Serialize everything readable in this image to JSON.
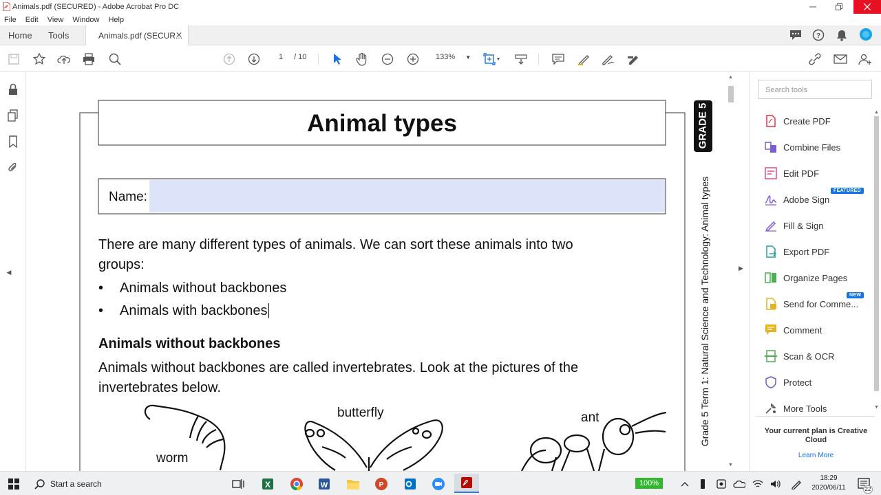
{
  "window": {
    "title": "Animals.pdf (SECURED) - Adobe Acrobat Pro DC"
  },
  "menu": [
    "File",
    "Edit",
    "View",
    "Window",
    "Help"
  ],
  "tabs": {
    "home": "Home",
    "tools": "Tools",
    "document": "Animals.pdf (SECUR..."
  },
  "toolbar": {
    "page_current": "1",
    "page_total": "/ 10",
    "zoom": "133%"
  },
  "document": {
    "title": "Animal types",
    "name_label": "Name:",
    "intro_line1": "There are many different types of animals. We can sort these animals into two",
    "intro_line2": "groups:",
    "bullets": [
      "Animals without backbones",
      "Animals with backbones"
    ],
    "section_heading": "Animals without backbones",
    "section_line1": "Animals without backbones are called invertebrates. Look at the pictures of the",
    "section_line2": "invertebrates below.",
    "image_labels": [
      "butterfly",
      "ant",
      "worm"
    ],
    "side_grade": "GRADE 5",
    "side_text": "Grade 5 Term 1: Natural Science and Technology: Animal types"
  },
  "right_panel": {
    "search_placeholder": "Search tools",
    "tools": [
      {
        "label": "Create PDF",
        "icon": "create-pdf-icon",
        "color": "#e0383e"
      },
      {
        "label": "Combine Files",
        "icon": "combine-files-icon",
        "color": "#7e5cd6"
      },
      {
        "label": "Edit PDF",
        "icon": "edit-pdf-icon",
        "color": "#e04a8c"
      },
      {
        "label": "Adobe Sign",
        "icon": "adobe-sign-icon",
        "color": "#7e5cd6",
        "badge": "FEATURED"
      },
      {
        "label": "Fill & Sign",
        "icon": "fill-sign-icon",
        "color": "#7e5cd6"
      },
      {
        "label": "Export PDF",
        "icon": "export-pdf-icon",
        "color": "#1fa59d"
      },
      {
        "label": "Organize Pages",
        "icon": "organize-pages-icon",
        "color": "#4caf50"
      },
      {
        "label": "Send for Comme...",
        "icon": "send-for-comment-icon",
        "color": "#e6b31e",
        "badge": "NEW"
      },
      {
        "label": "Comment",
        "icon": "comment-icon",
        "color": "#e6b31e"
      },
      {
        "label": "Scan & OCR",
        "icon": "scan-ocr-icon",
        "color": "#4caf50"
      },
      {
        "label": "Protect",
        "icon": "protect-icon",
        "color": "#6b5fc7"
      },
      {
        "label": "More Tools",
        "icon": "more-tools-icon",
        "color": "#555555"
      }
    ],
    "plan_text_line1": "Your current plan is Creative",
    "plan_text_line2": "Cloud",
    "learn_more": "Learn More"
  },
  "taskbar": {
    "search_placeholder": "Start a search",
    "battery": "100%",
    "time": "18:29",
    "date": "2020/06/11",
    "notifications": "22"
  }
}
